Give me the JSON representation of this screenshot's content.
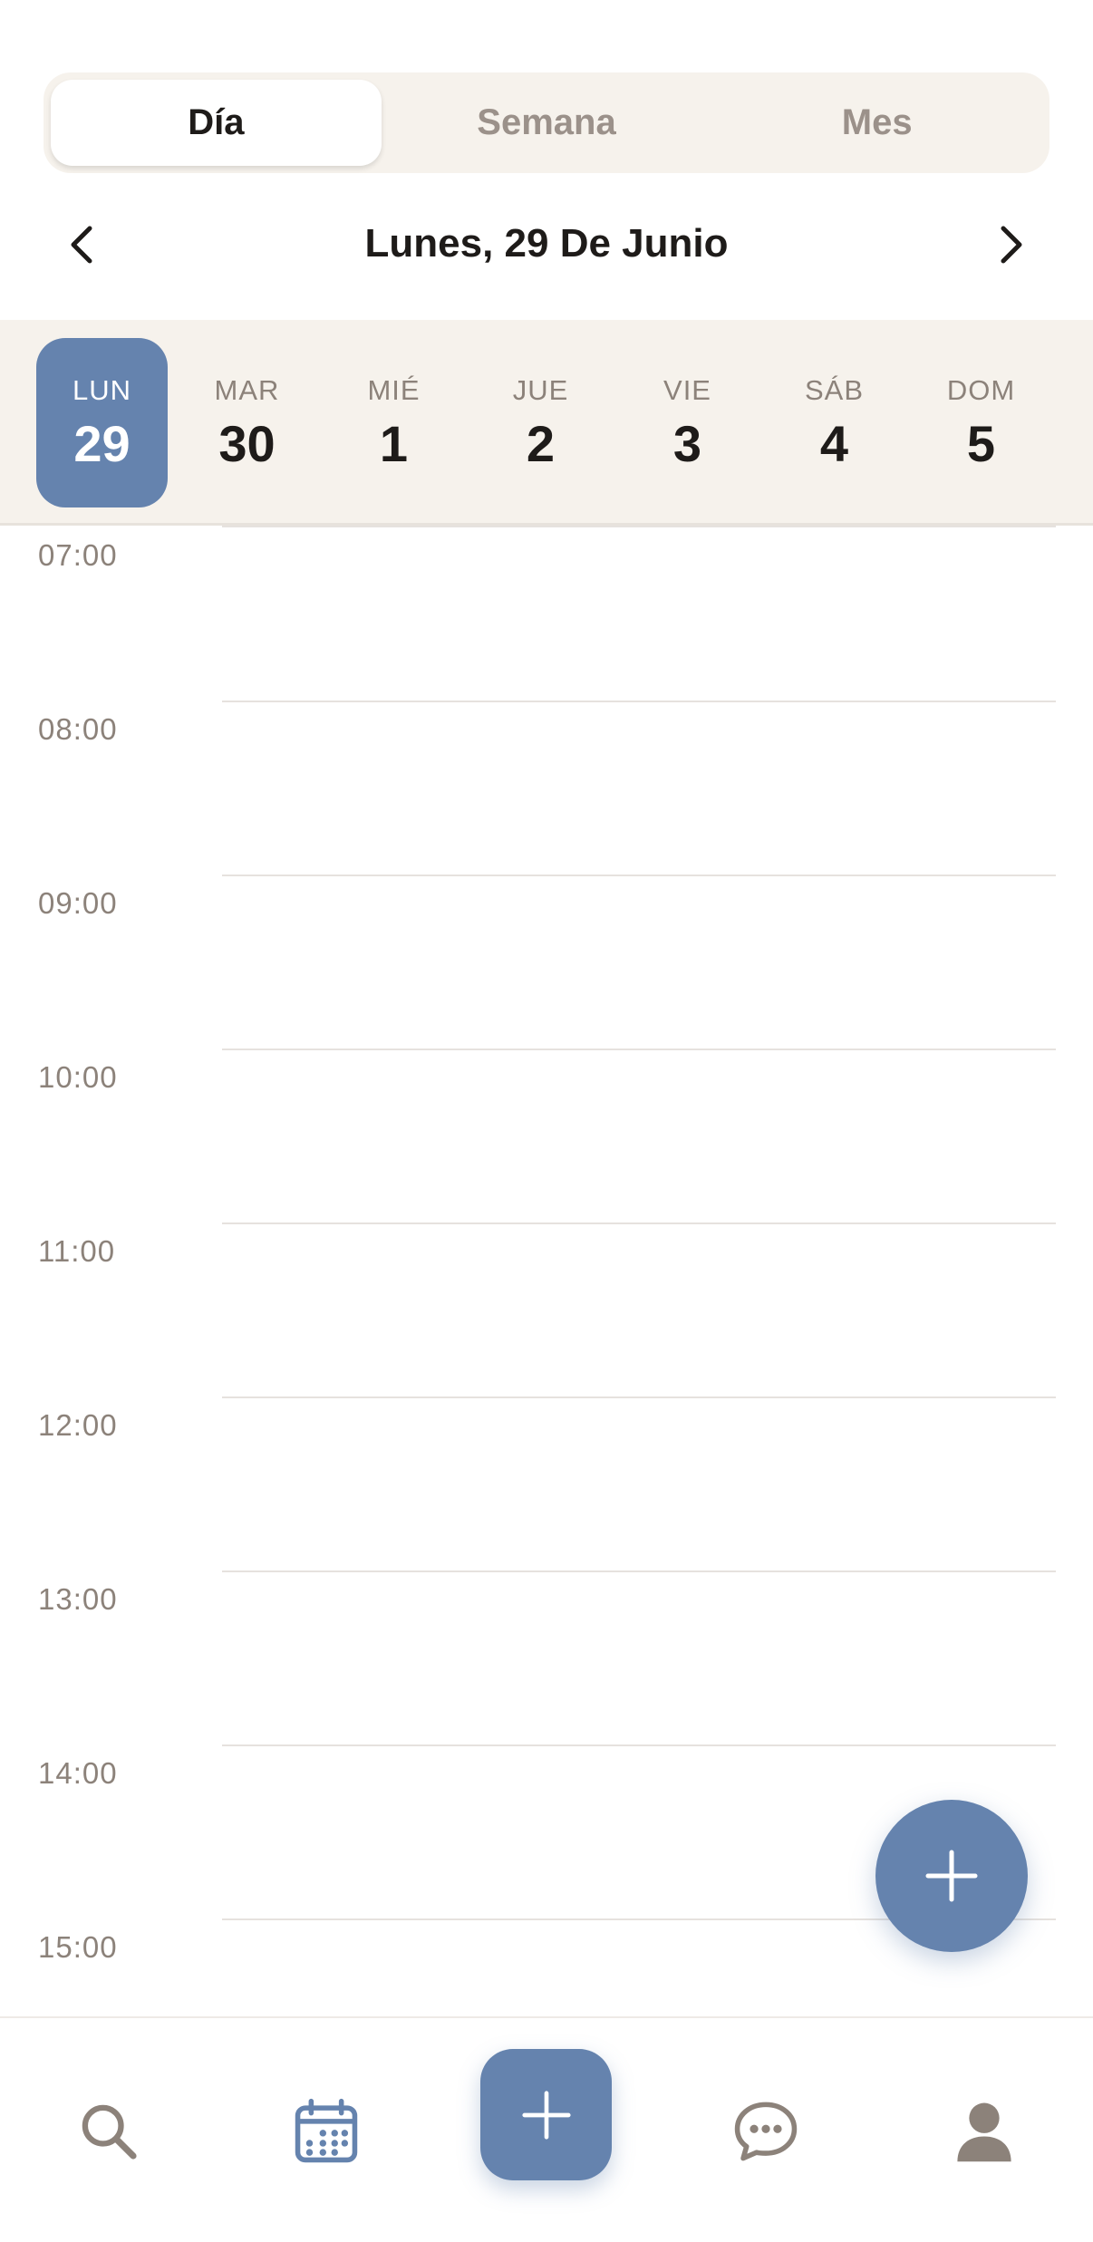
{
  "view_tabs": [
    {
      "label": "Día",
      "active": true
    },
    {
      "label": "Semana",
      "active": false
    },
    {
      "label": "Mes",
      "active": false
    }
  ],
  "date_nav": {
    "title": "Lunes, 29 De Junio",
    "prev_icon": "chevron-left-icon",
    "next_icon": "chevron-right-icon"
  },
  "week": [
    {
      "abbr": "LUN",
      "num": "29",
      "selected": true
    },
    {
      "abbr": "MAR",
      "num": "30",
      "selected": false
    },
    {
      "abbr": "MIÉ",
      "num": "1",
      "selected": false
    },
    {
      "abbr": "JUE",
      "num": "2",
      "selected": false
    },
    {
      "abbr": "VIE",
      "num": "3",
      "selected": false
    },
    {
      "abbr": "SÁB",
      "num": "4",
      "selected": false
    },
    {
      "abbr": "DOM",
      "num": "5",
      "selected": false
    }
  ],
  "hours": [
    "07:00",
    "08:00",
    "09:00",
    "10:00",
    "11:00",
    "12:00",
    "13:00",
    "14:00",
    "15:00"
  ],
  "fab_icon": "plus-icon",
  "bottom_nav": [
    {
      "icon": "search-icon"
    },
    {
      "icon": "calendar-icon"
    },
    {
      "icon": "plus-icon"
    },
    {
      "icon": "chat-icon"
    },
    {
      "icon": "profile-icon"
    }
  ],
  "colors": {
    "accent": "#6583ae",
    "strip_background": "#f6f2ec",
    "muted_text": "#8c827a",
    "grid_line": "#e6e2de"
  }
}
